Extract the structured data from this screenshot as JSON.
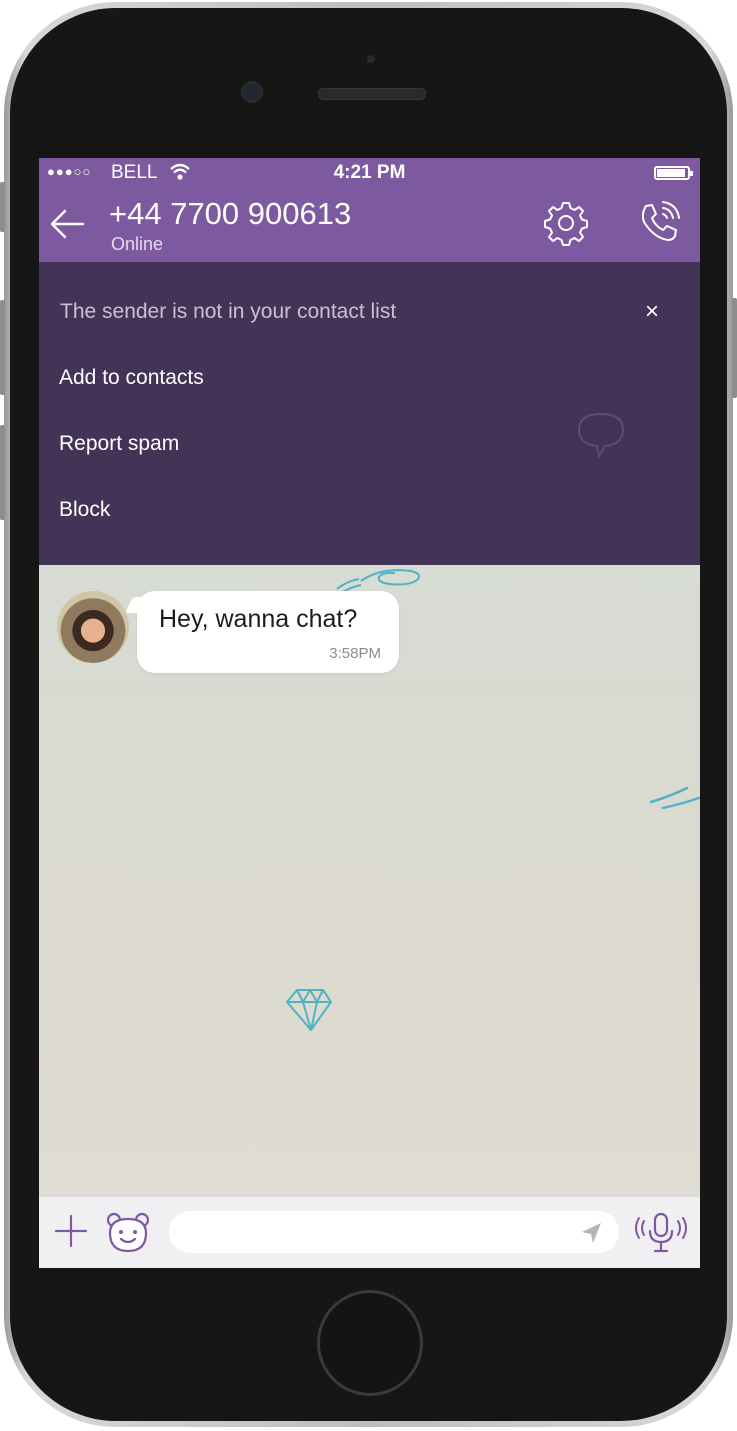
{
  "status_bar": {
    "signal": "●●●○○",
    "carrier": "BELL",
    "time": "4:21 PM"
  },
  "header": {
    "title": "+44 7700 900613",
    "subtitle": "Online"
  },
  "banner": {
    "message": "The sender is not in your contact list",
    "close": "×",
    "actions": [
      "Add to contacts",
      "Report spam",
      "Block"
    ]
  },
  "messages": [
    {
      "text": "Hey, wanna chat?",
      "time": "3:58PM"
    }
  ],
  "composer": {
    "placeholder": ""
  },
  "colors": {
    "brand": "#7d5a9f",
    "banner": "#433357",
    "icon_purple": "#7d5a9f"
  },
  "icons": [
    "back-arrow-icon",
    "gear-icon",
    "phone-call-icon",
    "close-icon",
    "plus-icon",
    "sticker-bear-icon",
    "send-icon",
    "microphone-icon"
  ]
}
